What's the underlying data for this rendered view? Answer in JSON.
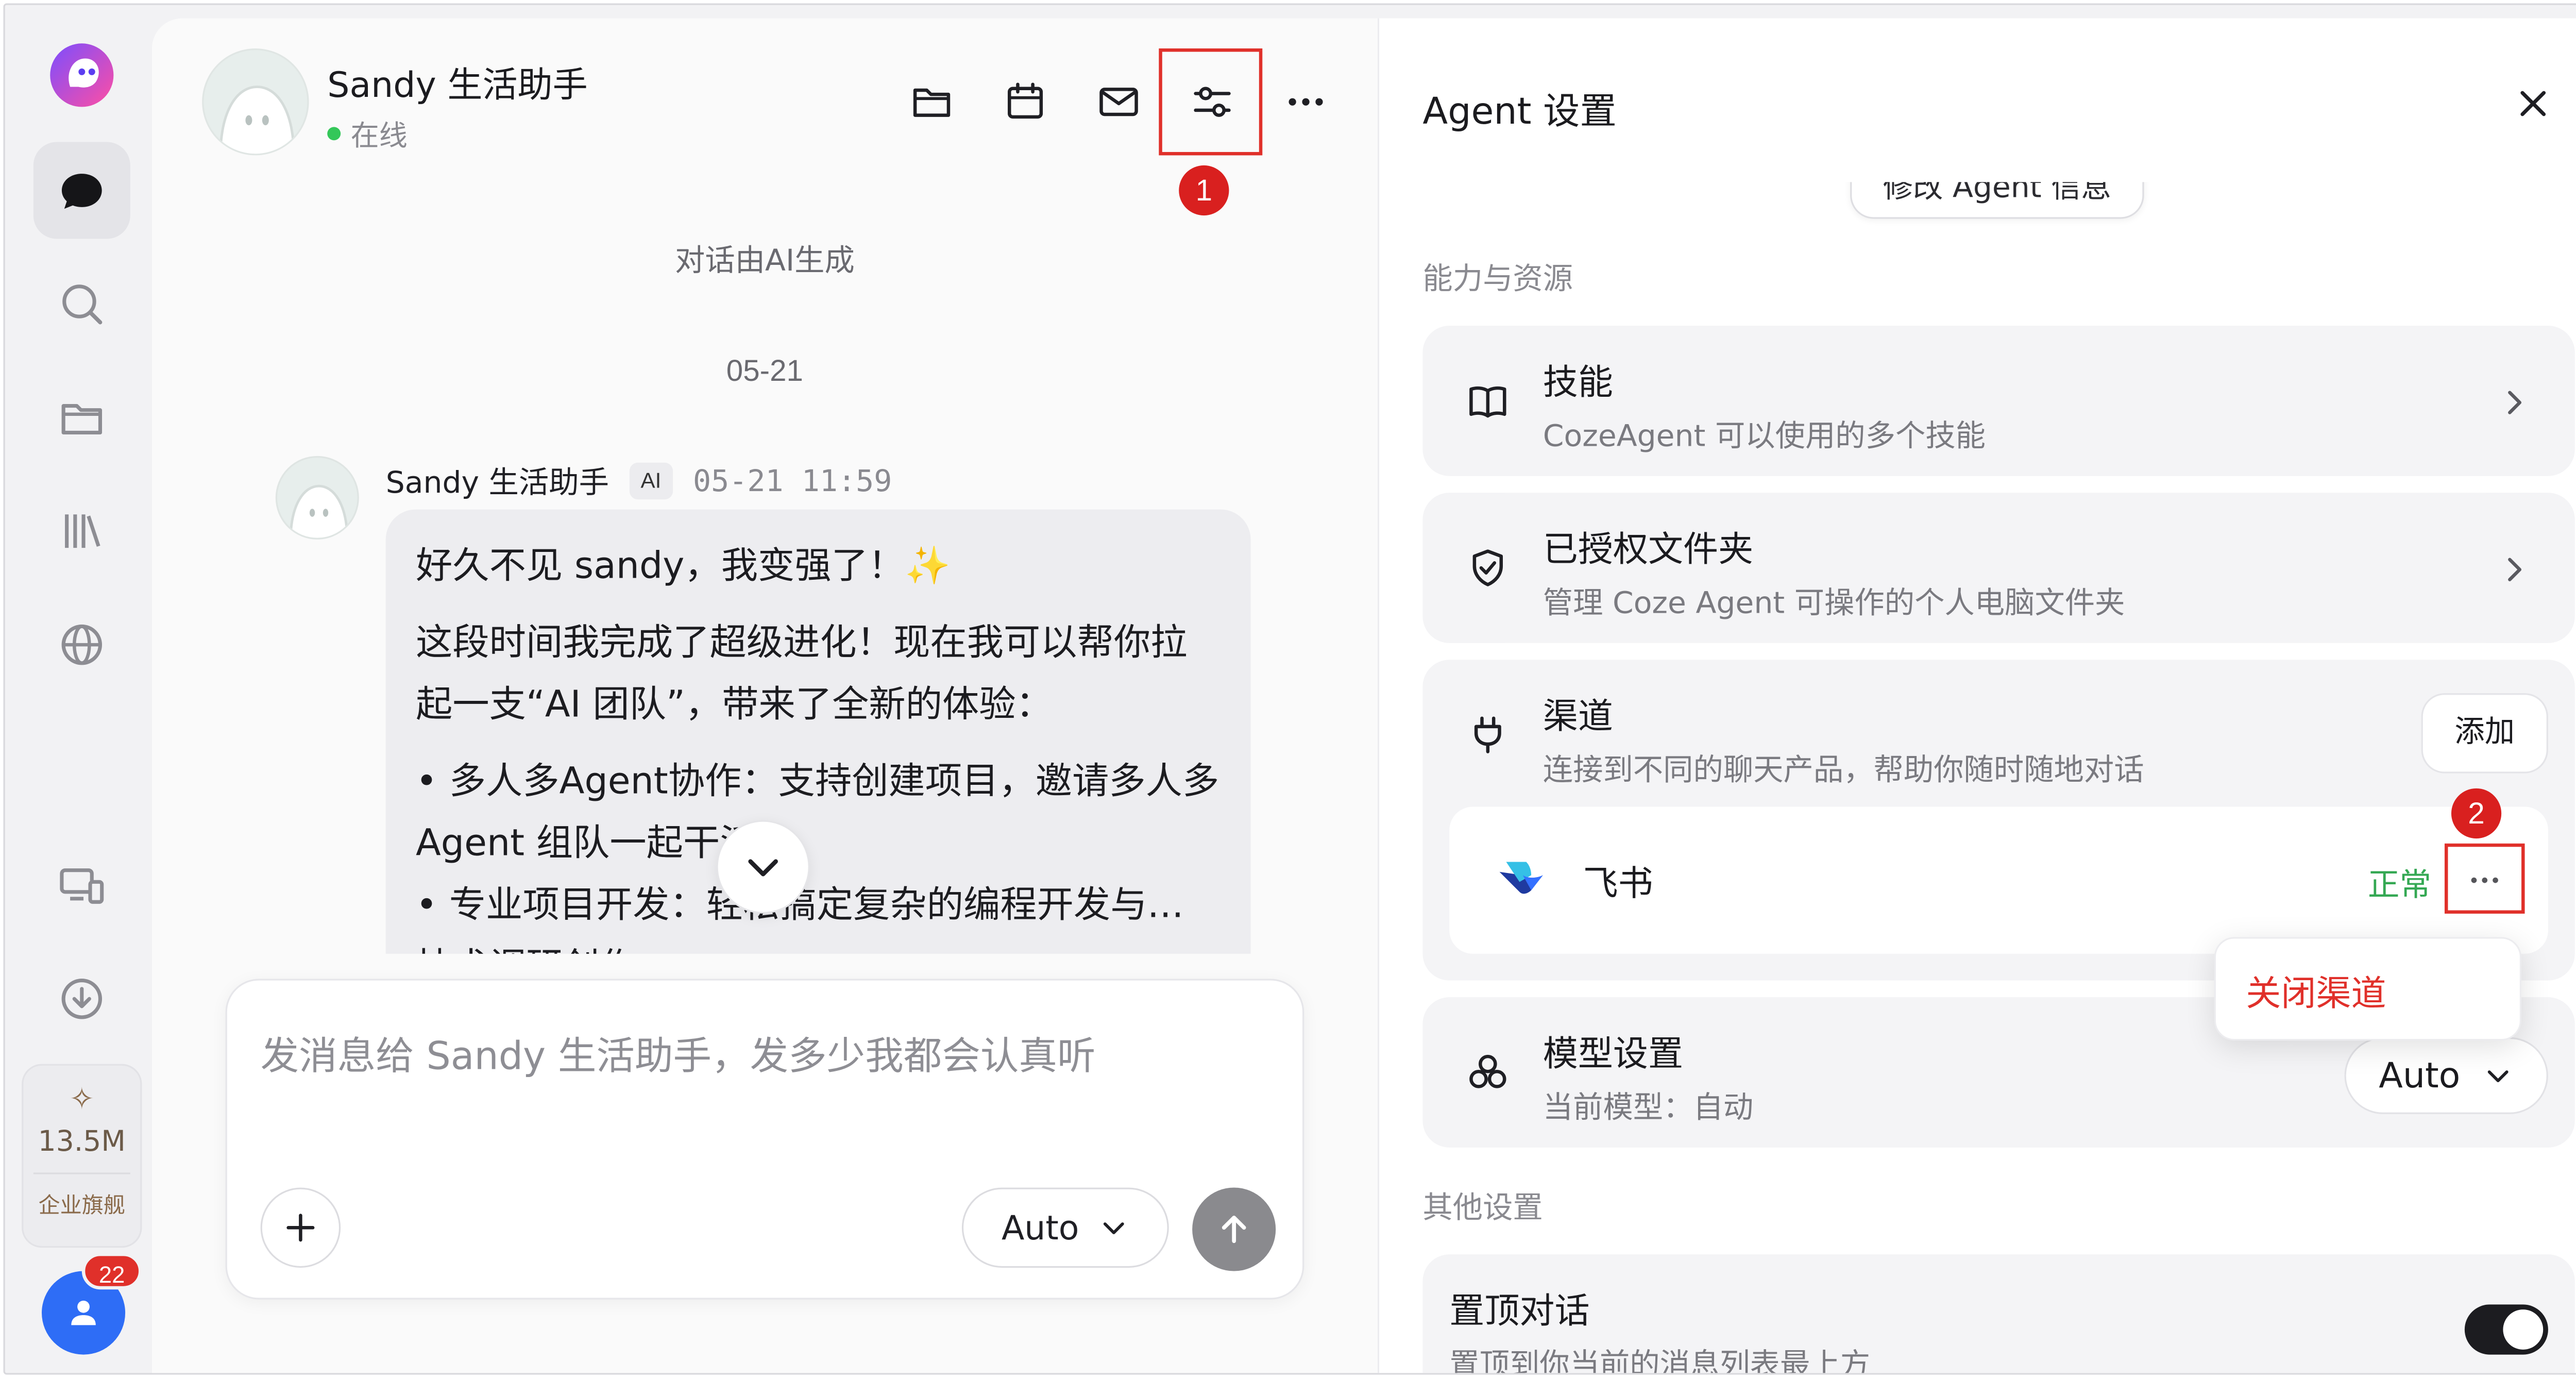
{
  "colors": {
    "accent_red": "#e0302a",
    "online_green": "#34c759",
    "status_ok": "#34a853",
    "user_blue": "#2e6df6"
  },
  "rail": {
    "items": [
      {
        "name": "chat",
        "icon": "chat-bubble-icon",
        "active": true
      },
      {
        "name": "search",
        "icon": "search-icon"
      },
      {
        "name": "folder",
        "icon": "folder-icon"
      },
      {
        "name": "library",
        "icon": "library-icon"
      },
      {
        "name": "explore",
        "icon": "globe-icon"
      },
      {
        "name": "devices",
        "icon": "devices-icon"
      },
      {
        "name": "download",
        "icon": "download-icon"
      }
    ],
    "quota_value": "13.5M",
    "quota_tier": "企业旗舰",
    "notification_count": "22"
  },
  "chat": {
    "agent_name": "Sandy 生活助手",
    "agent_status": "在线",
    "header_icons": [
      "folder-icon",
      "calendar-icon",
      "mail-icon",
      "settings-sliders-icon",
      "more-icon"
    ],
    "annotation_1": "1",
    "ai_note": "对话由AI生成",
    "date_divider": "05-21",
    "message": {
      "sender": "Sandy 生活助手",
      "tag": "AI",
      "time": "05-21 11:59",
      "lines": [
        "好久不见 sandy，我变强了！✨",
        "这段时间我完成了超级进化！现在我可以帮你拉起一支“AI 团队”，带来了全新的体验：",
        "• 多人多Agent协作：支持创建项目，邀请多人多 Agent 组队一起干活。",
        "• 专业项目开发：轻松搞定复杂的编程开发与… 技术调研创作"
      ]
    },
    "composer": {
      "placeholder": "发消息给 Sandy 生活助手，发多少我都会认真听",
      "model": "Auto"
    }
  },
  "settings": {
    "title": "Agent 设置",
    "edit_info_label": "修改 Agent 信息",
    "section_capabilities": "能力与资源",
    "skills": {
      "title": "技能",
      "subtitle": "CozeAgent 可以使用的多个技能"
    },
    "folders": {
      "title": "已授权文件夹",
      "subtitle": "管理 Coze Agent 可操作的个人电脑文件夹"
    },
    "channels": {
      "title": "渠道",
      "subtitle": "连接到不同的聊天产品，帮助你随时随地对话",
      "add_label": "添加",
      "annotation_2": "2",
      "items": [
        {
          "name": "飞书",
          "status": "正常"
        }
      ],
      "menu_close": "关闭渠道"
    },
    "model": {
      "title": "模型设置",
      "subtitle": "当前模型：自动",
      "value": "Auto"
    },
    "section_other": "其他设置",
    "pin": {
      "title": "置顶对话",
      "subtitle": "置顶到你当前的消息列表最上方",
      "enabled": true
    }
  }
}
